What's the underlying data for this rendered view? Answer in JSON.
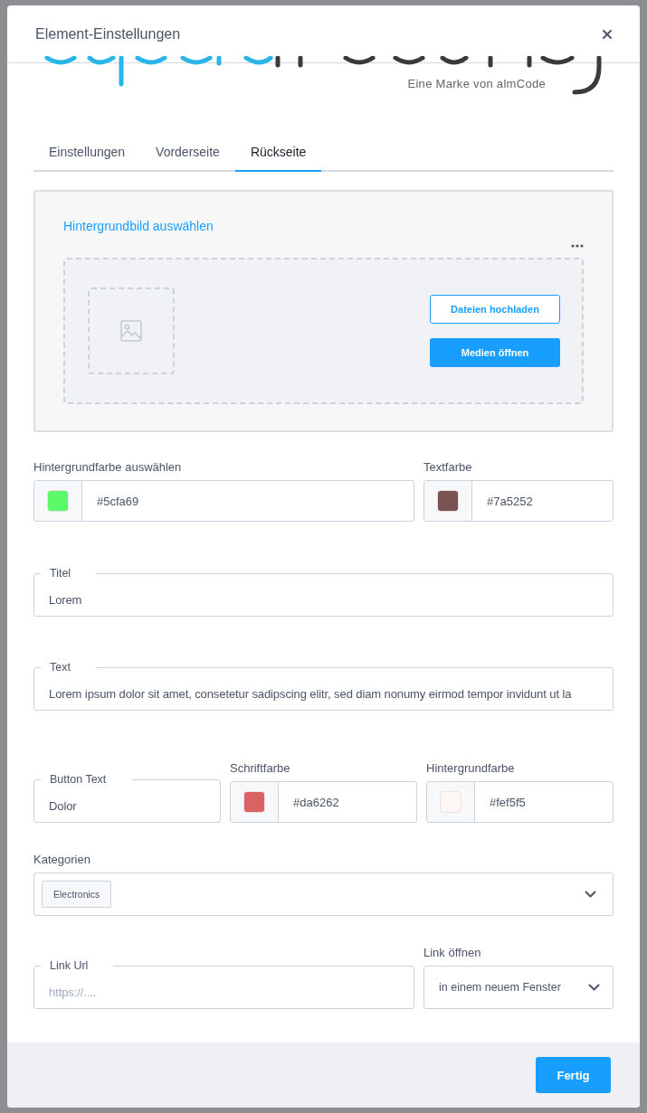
{
  "dialog": {
    "title": "Element-Einstellungen",
    "logo_tagline": "Eine Marke von almCode"
  },
  "tabs": [
    {
      "label": "Einstellungen",
      "selected": false
    },
    {
      "label": "Vorderseite",
      "selected": false
    },
    {
      "label": "Rückseite",
      "selected": true
    }
  ],
  "image_picker": {
    "title": "Hintergrundbild auswählen",
    "buttons": [
      {
        "label": "Dateien hochladen",
        "kind": "outline"
      },
      {
        "label": "Medien öffnen",
        "kind": "primary"
      }
    ]
  },
  "color_row": [
    {
      "label": "Hintergrundfarbe auswählen",
      "value": "#5cfa69",
      "color": "#5cfa69"
    },
    {
      "label": "Textfarbe",
      "value": "#7a5252",
      "color": "#7a5252"
    }
  ],
  "title_field": {
    "label": "Titel",
    "value": "Lorem"
  },
  "text_field": {
    "label": "Text",
    "value": "Lorem ipsum dolor sit amet, consetetur sadipscing elitr, sed diam nonumy eirmod tempor invidunt ut la"
  },
  "button_row": {
    "button_text": {
      "label": "Button Text",
      "value": "Dolor"
    },
    "colors": [
      {
        "label": "Schriftfarbe",
        "value": "#da6262",
        "color": "#da6262"
      },
      {
        "label": "Hintergrundfarbe",
        "value": "#fef5f5",
        "color": "#fef5f5"
      }
    ]
  },
  "categories": {
    "label": "Kategorien",
    "tags": [
      "Electronics"
    ]
  },
  "link": {
    "url": {
      "label": "Link Url",
      "placeholder": "https://...."
    },
    "open": {
      "label": "Link öffnen",
      "value": "in einem neuem Fenster"
    }
  },
  "footer": {
    "button": "Fertig"
  }
}
